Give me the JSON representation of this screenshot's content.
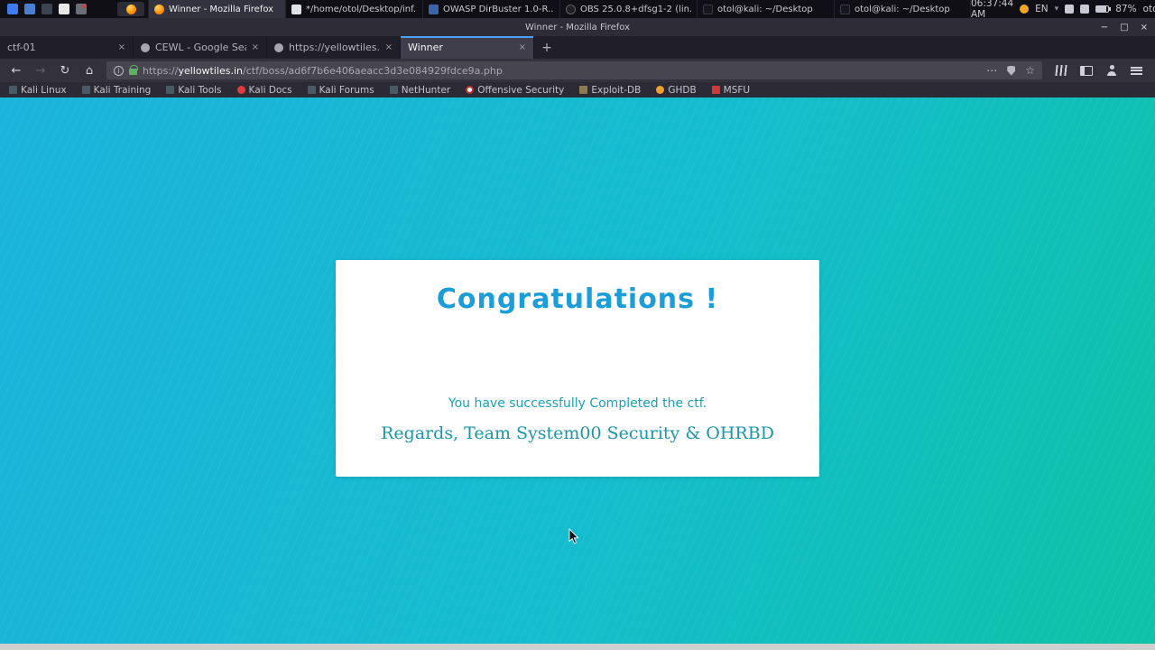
{
  "taskbar": {
    "clock": "06:37:44 AM",
    "keyboard_layout": "EN",
    "battery_percent": "87%",
    "user": "otol",
    "windows": [
      {
        "label": "Winner - Mozilla Firefox"
      },
      {
        "label": "*/home/otol/Desktop/inf..."
      },
      {
        "label": "OWASP DirBuster 1.0-R..."
      },
      {
        "label": "OBS 25.0.8+dfsg1-2 (lin..."
      },
      {
        "label": "otol@kali: ~/Desktop"
      },
      {
        "label": "otol@kali: ~/Desktop"
      }
    ]
  },
  "titlebar": {
    "title": "Winner - Mozilla Firefox"
  },
  "tabs": [
    {
      "label": "ctf-01"
    },
    {
      "label": "CEWL - Google Search"
    },
    {
      "label": "https://yellowtiles.in/ctf/"
    },
    {
      "label": "Winner"
    }
  ],
  "navbar": {
    "url_scheme": "https://",
    "url_domain": "yellowtiles.in",
    "url_path": "/ctf/boss/ad6f7b6e406aeacc3d3e084929fdce9a.php"
  },
  "bookmarks": [
    {
      "label": "Kali Linux"
    },
    {
      "label": "Kali Training"
    },
    {
      "label": "Kali Tools"
    },
    {
      "label": "Kali Docs"
    },
    {
      "label": "Kali Forums"
    },
    {
      "label": "NetHunter"
    },
    {
      "label": "Offensive Security"
    },
    {
      "label": "Exploit-DB"
    },
    {
      "label": "GHDB"
    },
    {
      "label": "MSFU"
    }
  ],
  "page": {
    "heading": "Congratulations !",
    "message": "You have successfully Completed the ctf.",
    "signature": "Regards, Team System00 Security & OHRBD"
  },
  "icons": {
    "close": "×",
    "minimize": "−",
    "maximize": "□",
    "new_tab": "+",
    "back": "←",
    "forward": "→",
    "reload": "↻",
    "home": "⌂",
    "info": "i",
    "page_actions": "⋯",
    "bookmark_star": "☆",
    "caret_down": "▾"
  },
  "colors": {
    "heading_color": "#1b9dd8",
    "message_color": "#1aa0b8",
    "signature_color": "#1b95a8",
    "bg_start": "#1cb3dc",
    "bg_mid": "#14bdcd",
    "bg_end": "#0dc3a6",
    "tab_accent": "#4b9ffa"
  }
}
